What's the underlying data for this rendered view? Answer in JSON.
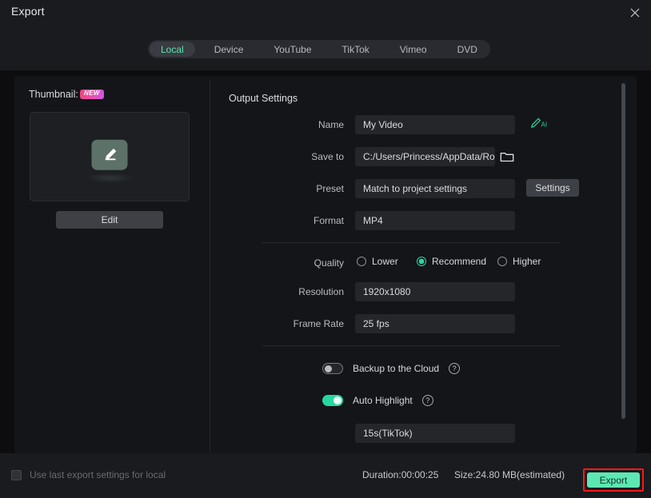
{
  "window": {
    "title": "Export",
    "close_icon": "close-icon"
  },
  "tabs": [
    {
      "label": "Local",
      "active": true
    },
    {
      "label": "Device",
      "active": false
    },
    {
      "label": "YouTube",
      "active": false
    },
    {
      "label": "TikTok",
      "active": false
    },
    {
      "label": "Vimeo",
      "active": false
    },
    {
      "label": "DVD",
      "active": false
    }
  ],
  "thumbnail": {
    "label": "Thumbnail:",
    "badge": "NEW",
    "edit_button": "Edit",
    "placeholder_icon": "pencil-edit-icon"
  },
  "output": {
    "section_title": "Output Settings",
    "name": {
      "label": "Name",
      "value": "My Video",
      "placeholder": "My Video",
      "ai_icon": "ai-pencil-icon"
    },
    "save_to": {
      "label": "Save to",
      "value": "C:/Users/Princess/AppData/Ro",
      "placeholder": "C:/Users/Princess/AppData/Ro",
      "browse_icon": "folder-icon"
    },
    "preset": {
      "label": "Preset",
      "value": "Match to project settings",
      "settings_button": "Settings"
    },
    "format": {
      "label": "Format",
      "value": "MP4"
    }
  },
  "quality": {
    "label": "Quality",
    "options": [
      {
        "label": "Lower",
        "selected": false
      },
      {
        "label": "Recommend",
        "selected": true
      },
      {
        "label": "Higher",
        "selected": false
      }
    ]
  },
  "resolution": {
    "label": "Resolution",
    "value": "1920x1080"
  },
  "frame_rate": {
    "label": "Frame Rate",
    "value": "25 fps"
  },
  "toggles": {
    "backup": {
      "label": "Backup to the Cloud",
      "on": false,
      "help_icon": "question-mark-icon",
      "help_glyph": "?"
    },
    "auto_highlight": {
      "label": "Auto Highlight",
      "on": true,
      "help_icon": "question-mark-icon",
      "help_glyph": "?"
    },
    "highlight_duration": {
      "value": "15s(TikTok)"
    }
  },
  "footer": {
    "use_last_settings": {
      "label": "Use last export settings for local",
      "checked": false
    },
    "duration": "Duration:00:00:25",
    "size": "Size:24.80 MB(estimated)",
    "export_button": "Export"
  },
  "colors": {
    "accent_green": "#27d7a0",
    "export_button_bg": "#5de8b2",
    "highlight_red": "#f51a1a",
    "badge_pink": "#f0457a",
    "window_bg": "#0d0d0f",
    "panel_bg": "#141518",
    "titlebar_bg": "#1a1b1f",
    "input_bg": "#242629"
  }
}
